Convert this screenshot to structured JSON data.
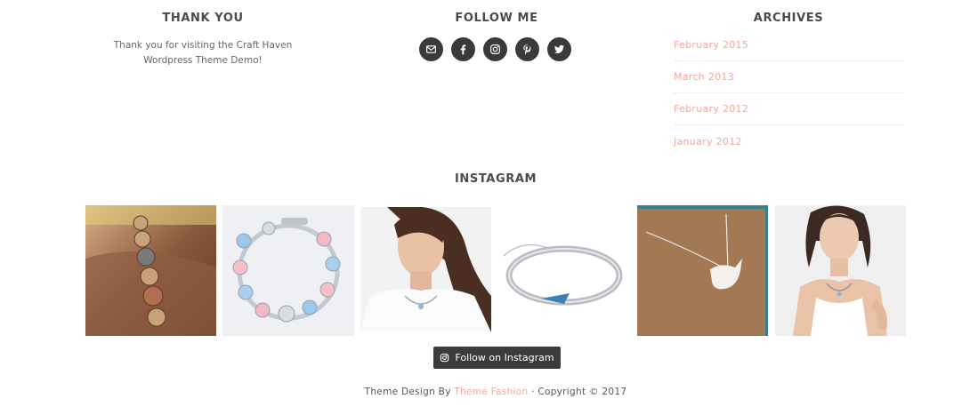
{
  "thank_you": {
    "title": "THANK YOU",
    "text_line1": "Thank you for visiting the Craft Haven",
    "text_line2": "Wordpress Theme Demo!"
  },
  "follow_me": {
    "title": "FOLLOW ME",
    "icons": [
      "email-icon",
      "facebook-icon",
      "instagram-icon",
      "pinterest-icon",
      "twitter-icon"
    ]
  },
  "archives": {
    "title": "ARCHIVES",
    "items": [
      "February 2015",
      "March 2013",
      "February 2012",
      "January 2012"
    ]
  },
  "instagram": {
    "title": "INSTAGRAM",
    "photos": [
      "beaded-bracelet-on-wrist",
      "charm-bracelet",
      "woman-with-necklace",
      "silver-bangle",
      "fox-pendant-necklace",
      "model-with-necklace"
    ],
    "follow_label": "Follow on Instagram"
  },
  "footer": {
    "prefix": "Theme Design By ",
    "link": "Theme Fashion",
    "suffix": " · Copyright © 2017"
  },
  "colors": {
    "accent": "#f2a89a",
    "dark": "#3a3a3a"
  }
}
